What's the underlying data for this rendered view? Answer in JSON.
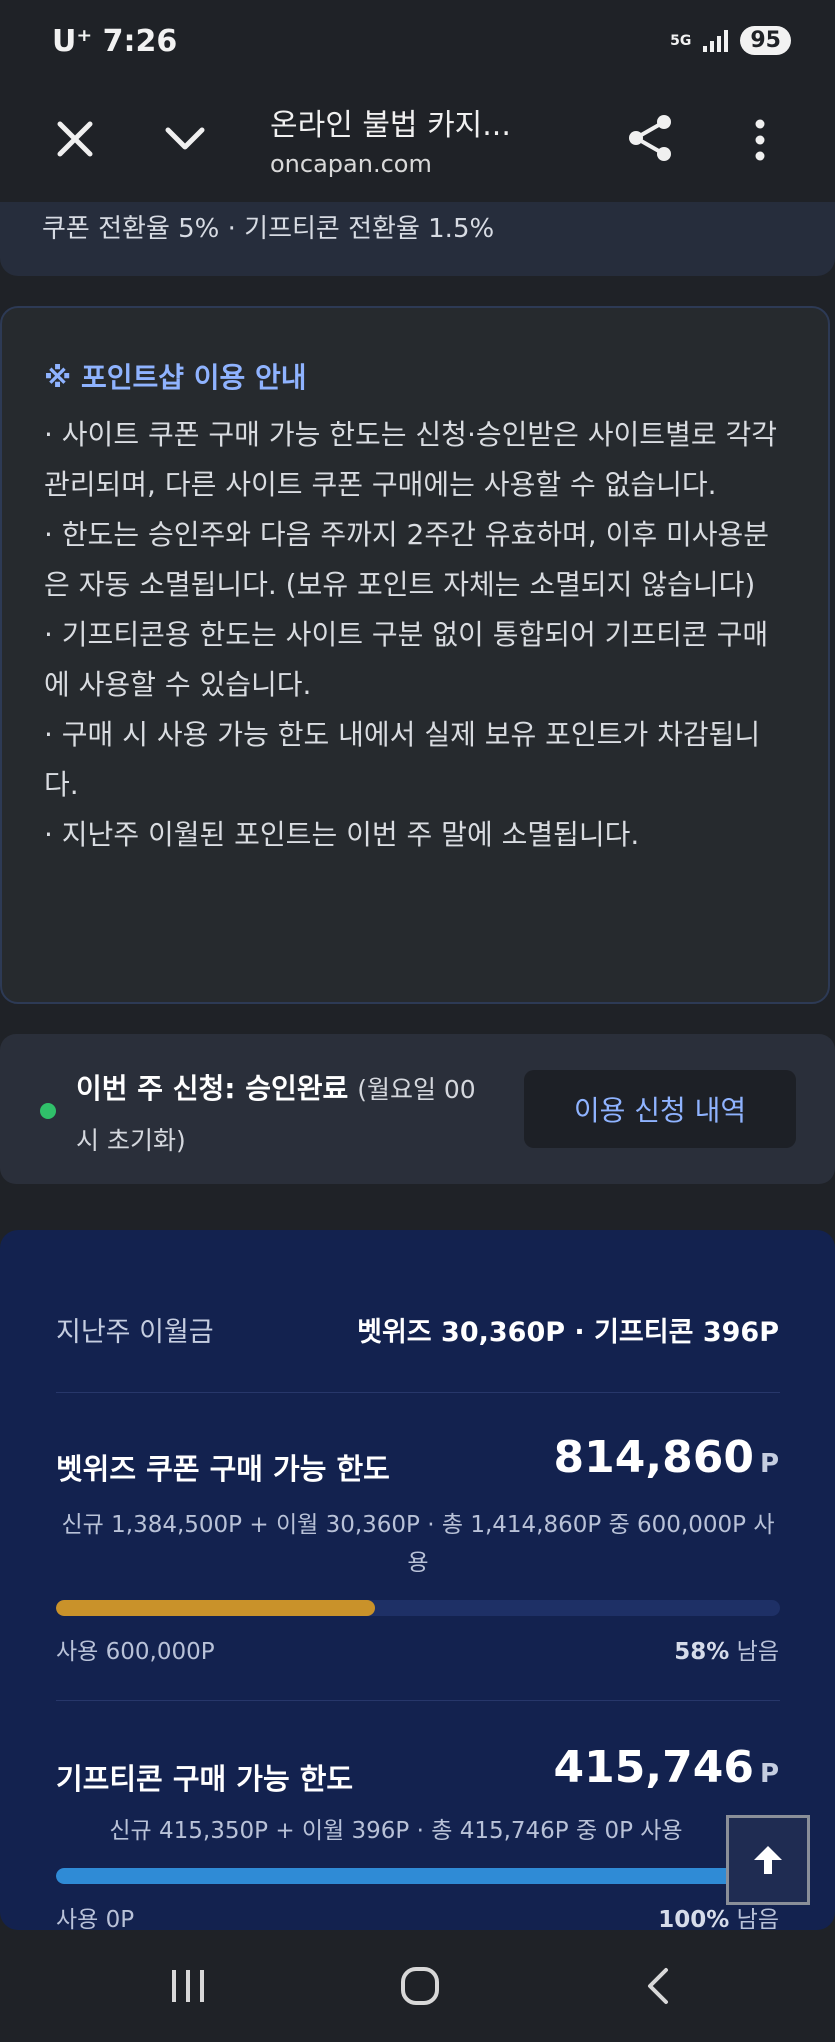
{
  "status_bar": {
    "carrier_time": "U⁺ 7:26",
    "network": "5G",
    "battery": "95"
  },
  "toolbar": {
    "title": "온라인 불법 카지...",
    "url": "oncapan.com"
  },
  "top_card": {
    "text": "쿠폰 전환율 5% · 기프티콘 전환율 1.5%"
  },
  "info": {
    "title": "※ 포인트샵 이용 안내",
    "lines": [
      "· 사이트 쿠폰 구매 가능 한도는 신청·승인받은 사이트별로 각각 관리되며, 다른 사이트 쿠폰 구매에는 사용할 수 없습니다.",
      "· 한도는 승인주와 다음 주까지 2주간 유효하며, 이후 미사용분은 자동 소멸됩니다. (보유 포인트 자체는 소멸되지 않습니다)",
      "· 기프티콘용 한도는 사이트 구분 없이 통합되어 기프티콘 구매에 사용할 수 있습니다.",
      "· 구매 시 사용 가능 한도 내에서 실제 보유 포인트가 차감됩니다.",
      "· 지난주 이월된 포인트는 이번 주 말에 소멸됩니다."
    ]
  },
  "request": {
    "label": "이번 주 신청: 승인완료",
    "note": "(월요일 00시 초기화)",
    "button": "이용 신청 내역",
    "status_color": "#30c06a"
  },
  "points": {
    "carry_label": "지난주 이월금",
    "carry_value": "벳위즈 30,360P · 기프티콘 396P",
    "limits": [
      {
        "title": "벳위즈 쿠폰 구매 가능 한도",
        "amount": "814,860",
        "unit": "P",
        "desc": "신규 1,384,500P + 이월 30,360P · 총 1,414,860P 중 600,000P 사용",
        "used": "사용 600,000P",
        "remain_pct": "58%",
        "remain_word": "남음",
        "used_fraction": 0.44,
        "bar_color": "#c9922a"
      },
      {
        "title": "기프티콘 구매 가능 한도",
        "amount": "415,746",
        "unit": "P",
        "desc": "신규 415,350P + 이월 396P · 총 415,746P 중 0P 사용",
        "used": "사용 0P",
        "remain_pct": "100%",
        "remain_word": "남음",
        "used_fraction": 0,
        "bar_color": "#2f8bd6"
      }
    ]
  }
}
